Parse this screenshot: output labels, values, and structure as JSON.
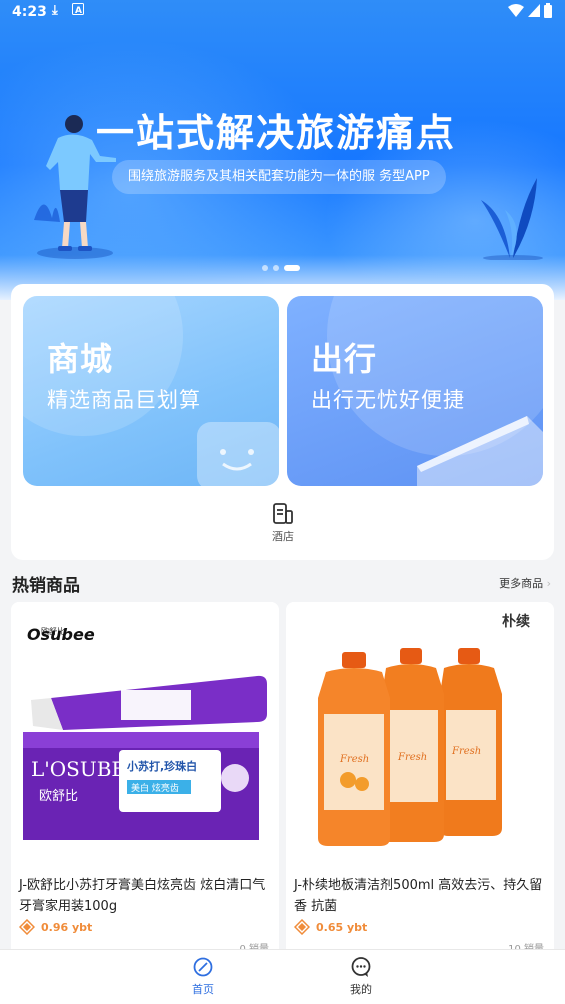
{
  "status_bar": {
    "time": "4:23"
  },
  "banner": {
    "headline": "一站式解决旅游痛点",
    "subtitle": "围绕旅游服务及其相关配套功能为一体的服 务型APP",
    "active_slide": 3,
    "slide_count": 3
  },
  "entries": {
    "mall": {
      "title": "商城",
      "subtitle": "精选商品巨划算"
    },
    "travel": {
      "title": "出行",
      "subtitle": "出行无忧好便捷"
    },
    "hotel": {
      "label": "酒店"
    }
  },
  "hot_products": {
    "title": "热销商品",
    "more": "更多商品",
    "items": [
      {
        "name": "J-欧舒比小苏打牙膏美白炫亮齿 炫白清口气牙膏家用装100g",
        "price": "0.96 ybt",
        "sales": "0 销量",
        "brand": "Osubee",
        "brand_cn": "欧舒比",
        "pack_brand": "L'OSUBEE",
        "pack_text": "小苏打,珍珠白",
        "pack_badge": "美白 炫亮齿"
      },
      {
        "name": "J-朴续地板清洁剂500ml 高效去污、持久留香 抗菌",
        "price": "0.65 ybt",
        "sales": "10 销量",
        "brand": "朴续",
        "bottle_text": "Fresh"
      }
    ]
  },
  "bottom_nav": {
    "home": "首页",
    "mine": "我的",
    "active": "home"
  },
  "colors": {
    "primary": "#1677ff",
    "price": "#f08c3a",
    "nav_active": "#2f6fe0"
  }
}
